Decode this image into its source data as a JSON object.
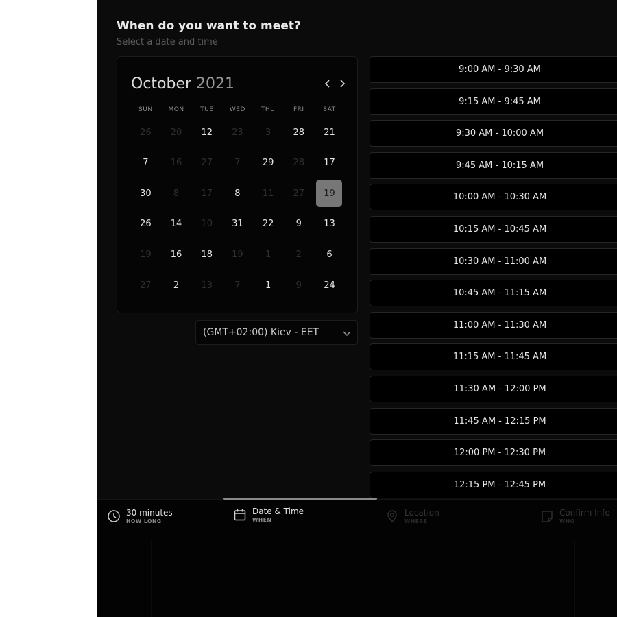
{
  "header": {
    "title": "When do you want to meet?",
    "subtitle": "Select a date and time"
  },
  "calendar": {
    "month": "October",
    "year": "2021",
    "prev_icon": "chevron-left-icon",
    "next_icon": "chevron-right-icon",
    "weekdays": [
      "SUN",
      "MON",
      "TUE",
      "WED",
      "THU",
      "FRI",
      "SAT"
    ],
    "weeks": [
      [
        {
          "d": "26",
          "m": true
        },
        {
          "d": "20",
          "m": true
        },
        {
          "d": "12",
          "m": false
        },
        {
          "d": "23",
          "m": true
        },
        {
          "d": "3",
          "m": true
        },
        {
          "d": "28",
          "m": false
        },
        {
          "d": "21",
          "m": false
        }
      ],
      [
        {
          "d": "7",
          "m": false
        },
        {
          "d": "16",
          "m": true
        },
        {
          "d": "27",
          "m": true
        },
        {
          "d": "7",
          "m": true
        },
        {
          "d": "29",
          "m": false
        },
        {
          "d": "28",
          "m": true
        },
        {
          "d": "17",
          "m": false
        }
      ],
      [
        {
          "d": "30",
          "m": false
        },
        {
          "d": "8",
          "m": true
        },
        {
          "d": "17",
          "m": true
        },
        {
          "d": "8",
          "m": false
        },
        {
          "d": "11",
          "m": true
        },
        {
          "d": "27",
          "m": true
        },
        {
          "d": "19",
          "m": false,
          "selected": true
        }
      ],
      [
        {
          "d": "26",
          "m": false
        },
        {
          "d": "14",
          "m": false
        },
        {
          "d": "10",
          "m": true
        },
        {
          "d": "31",
          "m": false
        },
        {
          "d": "22",
          "m": false
        },
        {
          "d": "9",
          "m": false
        },
        {
          "d": "13",
          "m": false
        }
      ],
      [
        {
          "d": "19",
          "m": true
        },
        {
          "d": "16",
          "m": false
        },
        {
          "d": "18",
          "m": false
        },
        {
          "d": "19",
          "m": true
        },
        {
          "d": "1",
          "m": true
        },
        {
          "d": "2",
          "m": true
        },
        {
          "d": "6",
          "m": false
        }
      ],
      [
        {
          "d": "27",
          "m": true
        },
        {
          "d": "2",
          "m": false
        },
        {
          "d": "13",
          "m": true
        },
        {
          "d": "7",
          "m": true
        },
        {
          "d": "1",
          "m": false
        },
        {
          "d": "9",
          "m": true
        },
        {
          "d": "24",
          "m": false
        }
      ]
    ]
  },
  "timezone": {
    "label": "(GMT+02:00) Kiev - EET",
    "icon": "chevron-down-icon"
  },
  "time_slots": [
    "9:00 AM - 9:30 AM",
    "9:15 AM - 9:45 AM",
    "9:30 AM - 10:00 AM",
    "9:45 AM - 10:15 AM",
    "10:00 AM - 10:30 AM",
    "10:15 AM - 10:45 AM",
    "10:30 AM - 11:00 AM",
    "10:45 AM - 11:15 AM",
    "11:00 AM - 11:30 AM",
    "11:15 AM - 11:45 AM",
    "11:30 AM - 12:00 PM",
    "11:45 AM - 12:15 PM",
    "12:00 PM - 12:30 PM",
    "12:15 PM - 12:45 PM"
  ],
  "steps": [
    {
      "label": "30 minutes",
      "sub": "HOW LONG",
      "icon": "clock-icon",
      "active": true
    },
    {
      "label": "Date & Time",
      "sub": "WHEN",
      "icon": "calendar-icon",
      "active": true
    },
    {
      "label": "Location",
      "sub": "WHERE",
      "icon": "location-pin-icon",
      "active": false
    },
    {
      "label": "Confirm Info",
      "sub": "WHO",
      "icon": "note-icon",
      "active": false
    }
  ],
  "colors": {
    "background": "#0b0b0b",
    "selected_day": "#777777",
    "progress": "#8a8a8a"
  }
}
